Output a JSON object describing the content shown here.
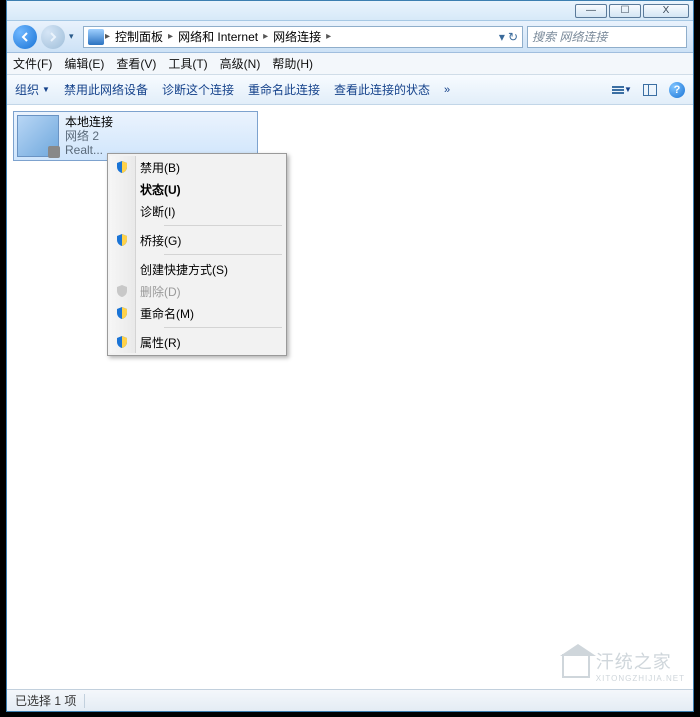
{
  "titlebar": {
    "min": "—",
    "max": "☐",
    "close": "X"
  },
  "address": {
    "crumbs": [
      "控制面板",
      "网络和 Internet",
      "网络连接"
    ],
    "sep": "▸",
    "dropdown": "▾",
    "refresh": "↻"
  },
  "search": {
    "placeholder": "搜索 网络连接"
  },
  "menubar": {
    "file": "文件(F)",
    "edit": "编辑(E)",
    "view": "查看(V)",
    "tools": "工具(T)",
    "advanced": "高级(N)",
    "help": "帮助(H)"
  },
  "toolbar": {
    "organize": "组织",
    "disable_device": "禁用此网络设备",
    "diagnose": "诊断这个连接",
    "rename": "重命名此连接",
    "view_status": "查看此连接的状态",
    "more": "»",
    "help": "?"
  },
  "connection": {
    "name": "本地连接",
    "line2": "网络 2",
    "line3": "Realt..."
  },
  "contextmenu": {
    "disable": "禁用(B)",
    "status": "状态(U)",
    "diagnose": "诊断(I)",
    "bridge": "桥接(G)",
    "shortcut": "创建快捷方式(S)",
    "delete": "删除(D)",
    "rename": "重命名(M)",
    "properties": "属性(R)"
  },
  "statusbar": {
    "selected": "已选择 1 项"
  },
  "watermark": {
    "title": "汗统之家",
    "sub": "XITONGZHIJIA.NET"
  }
}
